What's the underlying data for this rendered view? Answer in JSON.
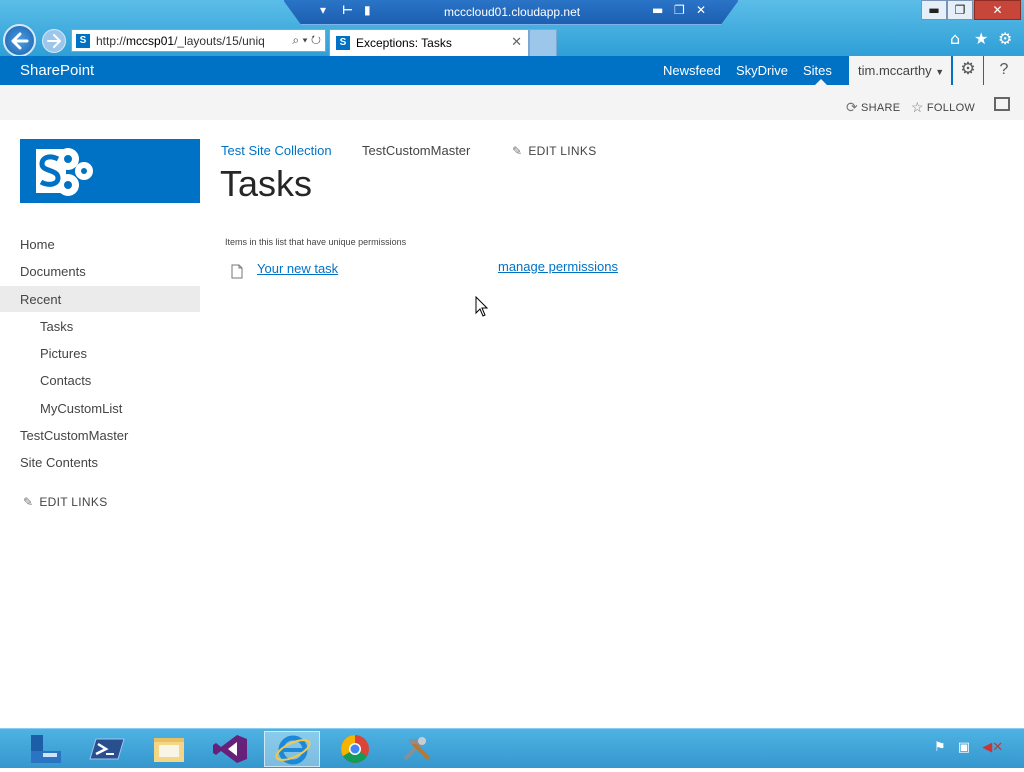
{
  "remote_bar": {
    "title": "mcccloud01.cloudapp.net"
  },
  "window_controls": {
    "minimize": "▬",
    "maximize": "❐",
    "close": "✕"
  },
  "browser": {
    "url_prefix": "http://",
    "url_host": "mccsp01",
    "url_path": "/_layouts/15/uniq",
    "tab_title": "Exceptions: Tasks",
    "tab_close": "✕"
  },
  "suite_bar": {
    "brand": "SharePoint",
    "links": [
      "Newsfeed",
      "SkyDrive",
      "Sites"
    ],
    "user": "tim.mccarthy",
    "help": "?"
  },
  "ribbon": {
    "share": "SHARE",
    "follow": "FOLLOW"
  },
  "top_nav": {
    "items": [
      "Test Site Collection",
      "TestCustomMaster"
    ],
    "edit_links": "EDIT LINKS"
  },
  "page": {
    "title": "Tasks"
  },
  "quick_launch": {
    "items": [
      {
        "label": "Home",
        "indent": 0
      },
      {
        "label": "Documents",
        "indent": 0
      },
      {
        "label": "Recent",
        "indent": 0,
        "selected": true
      },
      {
        "label": "Tasks",
        "indent": 1
      },
      {
        "label": "Pictures",
        "indent": 1
      },
      {
        "label": "Contacts",
        "indent": 1
      },
      {
        "label": "MyCustomList",
        "indent": 1
      },
      {
        "label": "TestCustomMaster",
        "indent": 0
      },
      {
        "label": "Site Contents",
        "indent": 0
      }
    ],
    "edit_links": "EDIT LINKS"
  },
  "content": {
    "note": "Items in this list that have unique permissions",
    "item_label": "Your new task",
    "manage_label": "manage permissions"
  },
  "taskbar": {
    "apps": [
      "server-manager",
      "powershell",
      "file-explorer",
      "visual-studio",
      "internet-explorer",
      "chrome",
      "tools"
    ],
    "active": "internet-explorer"
  },
  "colors": {
    "accent": "#0072c6",
    "ribbon": "#f4f4f4"
  }
}
